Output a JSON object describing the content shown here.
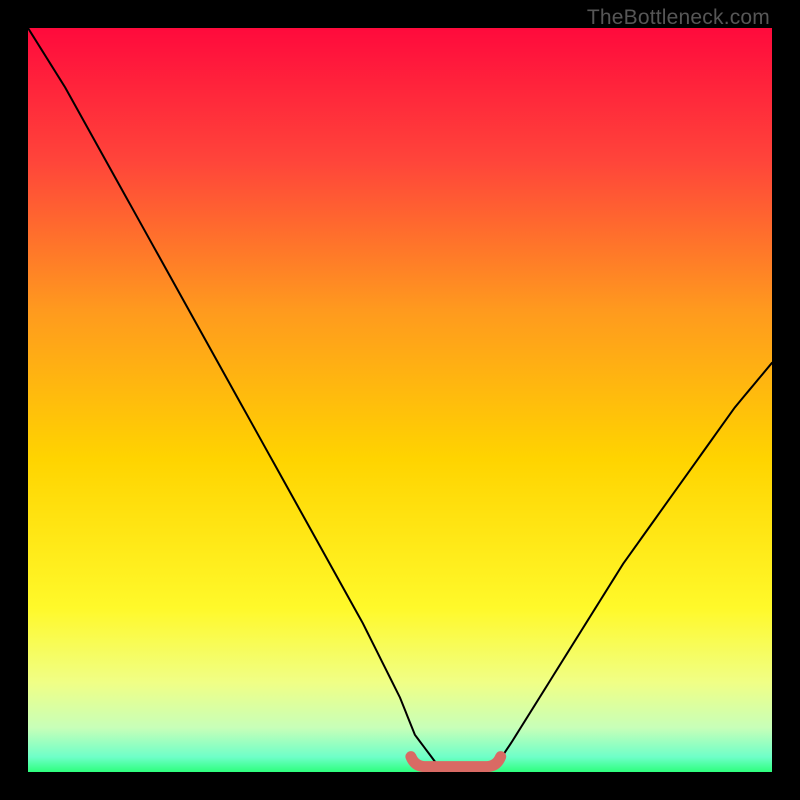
{
  "watermark": "TheBottleneck.com",
  "colors": {
    "background": "#000000",
    "gradient_top": "#ff0a3c",
    "gradient_mid1": "#ff6a28",
    "gradient_mid2": "#ffd400",
    "gradient_low1": "#f6ff60",
    "gradient_low2": "#d6ffb0",
    "gradient_bottom": "#2eff7e",
    "curve": "#000000",
    "flat_segment": "#d96a64"
  },
  "chart_data": {
    "type": "line",
    "title": "",
    "xlabel": "",
    "ylabel": "",
    "xlim": [
      0,
      100
    ],
    "ylim": [
      0,
      100
    ],
    "series": [
      {
        "name": "bottleneck-curve",
        "x": [
          0,
          5,
          10,
          15,
          20,
          25,
          30,
          35,
          40,
          45,
          50,
          52,
          55,
          58,
          60,
          63,
          65,
          70,
          75,
          80,
          85,
          90,
          95,
          100
        ],
        "values": [
          100,
          92,
          83,
          74,
          65,
          56,
          47,
          38,
          29,
          20,
          10,
          5,
          1,
          1,
          1,
          1,
          4,
          12,
          20,
          28,
          35,
          42,
          49,
          55
        ]
      }
    ],
    "flat_segment": {
      "x_start": 52,
      "x_end": 63,
      "y": 1
    },
    "annotations": []
  }
}
